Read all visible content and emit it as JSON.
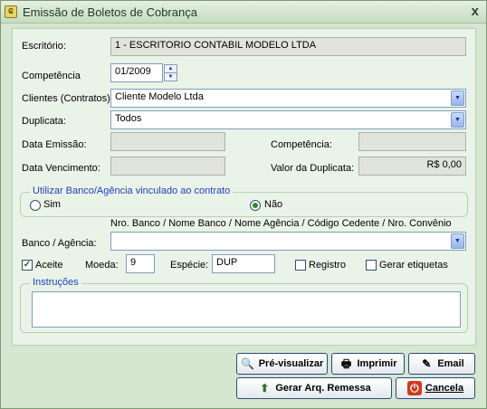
{
  "window": {
    "title": "Emissão de Boletos de Cobrança",
    "close": "x"
  },
  "form": {
    "escritorio_label": "Escritório:",
    "escritorio_value": "1 - ESCRITORIO CONTABIL MODELO LTDA",
    "competencia_label": "Competência",
    "competencia_value": "01/2009",
    "clientes_label": "Clientes (Contratos):",
    "clientes_value": "Cliente Modelo Ltda",
    "duplicata_label": "Duplicata:",
    "duplicata_value": "Todos",
    "data_emissao_label": "Data Emissão:",
    "competencia2_label": "Competência:",
    "data_vencimento_label": "Data Vencimento:",
    "valor_duplicata_label": "Valor da Duplicata:",
    "valor_duplicata_value": "R$ 0,00"
  },
  "banco_group": {
    "title": "Utilizar Banco/Agência vinculado ao contrato",
    "sim": "Sim",
    "nao": "Não",
    "selected": "Não"
  },
  "banco": {
    "hint": "Nro. Banco / Nome Banco / Nome Agência / Código Cedente / Nro. Convênio",
    "label": "Banco / Agência:"
  },
  "options": {
    "aceite_label": "Aceite",
    "aceite_checked": true,
    "moeda_label": "Moeda:",
    "moeda_value": "9",
    "especie_label": "Espécie:",
    "especie_value": "DUP",
    "registro_label": "Registro",
    "registro_checked": false,
    "etiquetas_label": "Gerar etiquetas",
    "etiquetas_checked": false
  },
  "instrucoes": {
    "title": "Instruções",
    "value": ""
  },
  "buttons": {
    "preview": "Pré-visualizar",
    "print": "Imprimir",
    "email": "Email",
    "remessa": "Gerar Arq. Remessa",
    "cancel": "Cancela"
  },
  "icons": {
    "preview": "magnifier-icon",
    "print": "printer-icon",
    "email": "pen-icon",
    "remessa": "disk-arrow-icon",
    "cancel": "power-icon"
  },
  "colors": {
    "accent": "#1f3fbf",
    "background": "#d5e6d1"
  }
}
